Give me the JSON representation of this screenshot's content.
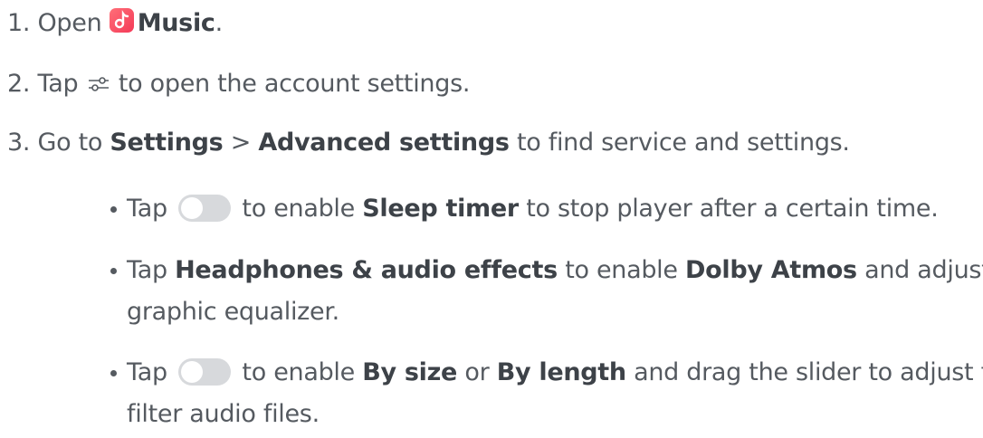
{
  "steps": [
    {
      "num": "1.",
      "pre": "Open",
      "app": "Music",
      "post": "."
    },
    {
      "num": "2.",
      "pre": "Tap",
      "post": "to open the account settings."
    },
    {
      "num": "3.",
      "pre": "Go to",
      "b1": "Settings",
      "sep": ">",
      "b2": "Advanced settings",
      "post": "to find service and settings."
    }
  ],
  "bullets": [
    {
      "pre": "Tap",
      "mid": "to enable",
      "b1": "Sleep timer",
      "post": "to stop player after a certain time."
    },
    {
      "pre": "Tap",
      "b1": "Headphones & audio effects",
      "mid": "to enable",
      "b2": "Dolby Atmos",
      "post": "and adjust",
      "line2": "graphic equalizer."
    },
    {
      "pre": "Tap",
      "mid": "to enable",
      "b1": "By size",
      "or": "or",
      "b2": "By length",
      "post": "and drag the slider to adjust to",
      "line2": "filter audio files."
    }
  ],
  "icons": {
    "music_app": "music-app-icon",
    "settings": "sliders-settings-icon",
    "toggle": "toggle-switch-icon"
  },
  "colors": {
    "text": "#555a60",
    "bold": "#3d4248",
    "music_icon": "#f43a58",
    "toggle_track": "#d7d9dc"
  }
}
